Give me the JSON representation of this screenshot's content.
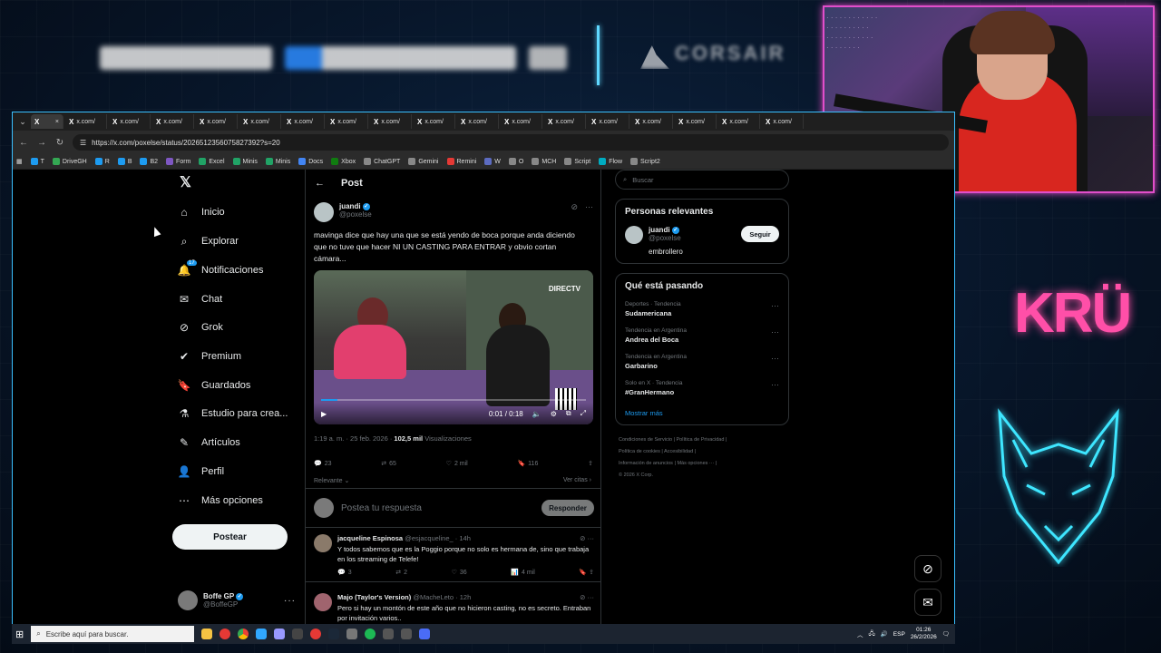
{
  "colors": {
    "accent": "#1d9bf0",
    "x_bg": "#000000",
    "overlay_cyan": "#3ac0ff",
    "overlay_pink": "#ff4fa8",
    "webcam_border": "#e14eca"
  },
  "overlay": {
    "brand": "CORSAIR",
    "logo_text": "KRÜ"
  },
  "browser": {
    "tabs": [
      "x.com/",
      "x.com/",
      "x.com/",
      "x.com/",
      "x.com/",
      "x.com/",
      "x.com/",
      "x.com/",
      "x.com/",
      "x.com/",
      "x.com/",
      "x.com/",
      "x.com/",
      "x.com/",
      "x.com/",
      "x.com/",
      "x.com/"
    ],
    "url": "https://x.com/poxelse/status/2026512356075827392?s=20",
    "bookmarks": [
      {
        "label": "T",
        "color": "#1d9bf0"
      },
      {
        "label": "DriveGH",
        "color": "#34a853"
      },
      {
        "label": "R",
        "color": "#1d9bf0"
      },
      {
        "label": "B",
        "color": "#1d9bf0"
      },
      {
        "label": "B2",
        "color": "#1d9bf0"
      },
      {
        "label": "Form",
        "color": "#7e57c2"
      },
      {
        "label": "Excel",
        "color": "#21a366"
      },
      {
        "label": "Minis",
        "color": "#21a366"
      },
      {
        "label": "Minis",
        "color": "#21a366"
      },
      {
        "label": "Docs",
        "color": "#4285f4"
      },
      {
        "label": "Xbox",
        "color": "#107c10"
      },
      {
        "label": "ChatGPT",
        "color": "#888888"
      },
      {
        "label": "Gemini",
        "color": "#888888"
      },
      {
        "label": "Remini",
        "color": "#e53935"
      },
      {
        "label": "W",
        "color": "#5c6bc0"
      },
      {
        "label": "O",
        "color": "#888888"
      },
      {
        "label": "MCH",
        "color": "#888888"
      },
      {
        "label": "Script",
        "color": "#888888"
      },
      {
        "label": "Flow",
        "color": "#00acc1"
      },
      {
        "label": "Script2",
        "color": "#888888"
      }
    ]
  },
  "nav": {
    "items": [
      {
        "label": "Inicio",
        "icon": "home-icon"
      },
      {
        "label": "Explorar",
        "icon": "search-icon"
      },
      {
        "label": "Notificaciones",
        "icon": "bell-icon",
        "badge": "17"
      },
      {
        "label": "Chat",
        "icon": "mail-icon"
      },
      {
        "label": "Grok",
        "icon": "grok-icon"
      },
      {
        "label": "Premium",
        "icon": "premium-icon"
      },
      {
        "label": "Guardados",
        "icon": "bookmark-icon"
      },
      {
        "label": "Estudio para crea...",
        "icon": "studio-icon"
      },
      {
        "label": "Artículos",
        "icon": "articles-icon"
      },
      {
        "label": "Perfil",
        "icon": "profile-icon"
      },
      {
        "label": "Más opciones",
        "icon": "more-icon"
      }
    ],
    "post_button": "Postear",
    "account": {
      "name": "Boffe GP",
      "handle": "@BoffeGP"
    }
  },
  "post": {
    "header": "Post",
    "author": {
      "name": "juandi",
      "handle": "@poxelse"
    },
    "text": "mavinga dice que hay una que se está yendo de boca porque anda diciendo que no tuve que hacer NI UN CASTING PARA ENTRAR y obvio cortan cámara...",
    "media": {
      "watermark": "DIRECTV",
      "time": "0:01 / 0:18",
      "progress": 0.06
    },
    "time": "1:19 a. m.",
    "date": "25 feb. 2026",
    "views": "102,5 mil",
    "views_label": "Visualizaciones",
    "stats": {
      "replies": "23",
      "reposts": "65",
      "likes": "2 mil",
      "bookmarks": "116"
    },
    "sort": "Relevante",
    "quotes": "Ver citas"
  },
  "reply_box": {
    "placeholder": "Postea tu respuesta",
    "button": "Responder"
  },
  "replies": [
    {
      "name": "jacqueline Espinosa",
      "handle": "@esjacqueline_",
      "time": "14h",
      "text": "Y todos sabemos que es la Poggio porque no solo es hermana de, sino que trabaja en los streaming de Telefe!",
      "replies": "3",
      "reposts": "2",
      "likes": "36",
      "views": "4 mil"
    },
    {
      "name": "Majo (Taylor's Version)",
      "handle": "@MacheLeto",
      "time": "12h",
      "text": "Pero si hay un montón de este año que no hicieron casting, no es secreto. Entraban por invitación varios..",
      "replies": "",
      "reposts": "",
      "likes": "",
      "views": ""
    }
  ],
  "sidebar": {
    "search_placeholder": "Buscar",
    "relevant_title": "Personas relevantes",
    "relevant_user": {
      "name": "juandi",
      "handle": "@poxelse",
      "bio": "embrollero",
      "follow": "Seguir"
    },
    "trends_title": "Qué está pasando",
    "trends": [
      {
        "context": "Deportes · Tendencia",
        "name": "Sudamericana"
      },
      {
        "context": "Tendencia en Argentina",
        "name": "Andrea del Boca"
      },
      {
        "context": "Tendencia en Argentina",
        "name": "Garbarino"
      },
      {
        "context": "Solo en X · Tendencia",
        "name": "#GranHermano"
      }
    ],
    "show_more": "Mostrar más",
    "footer": [
      "Condiciones de Servicio",
      "Política de Privacidad",
      "Política de cookies",
      "Accesibilidad",
      "Información de anuncios",
      "Más opciones ···",
      "© 2026 X Corp."
    ]
  },
  "taskbar": {
    "search": "Escribe aquí para buscar.",
    "lang": "ESP",
    "time": "01:26",
    "date": "26/2/2026"
  }
}
